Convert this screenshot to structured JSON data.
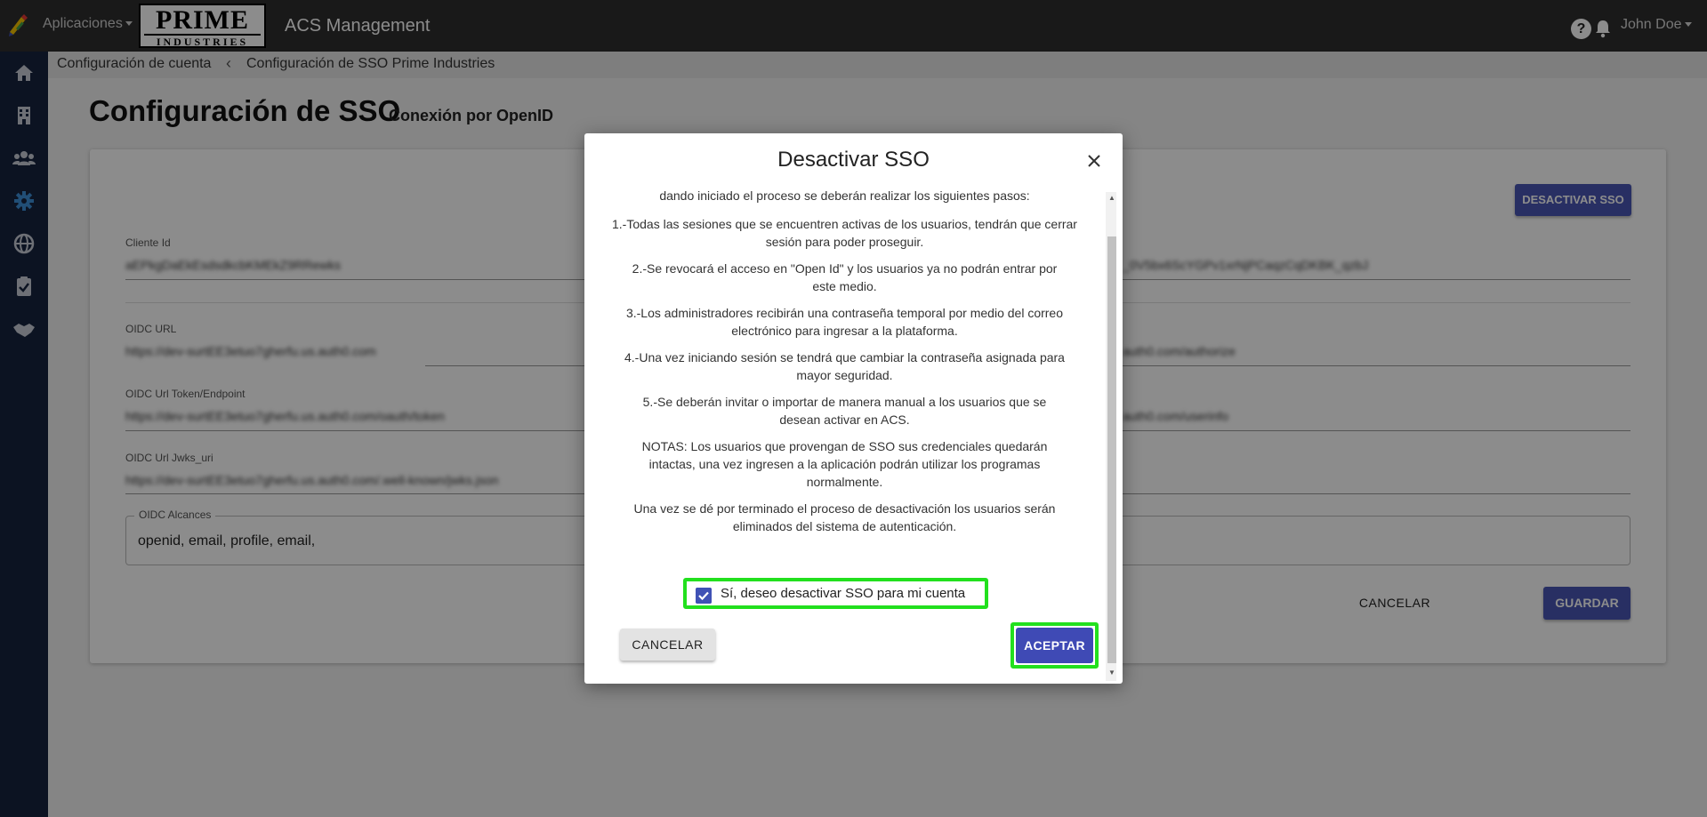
{
  "topbar": {
    "apps_label": "Aplicaciones",
    "brand_line1": "PRIME",
    "brand_line2": "INDUSTRIES",
    "app_title": "ACS Management",
    "help_glyph": "?",
    "user_name": "John Doe"
  },
  "sidebar": {
    "items": [
      "home-icon",
      "building-icon",
      "users-icon",
      "gear-icon",
      "globe-icon",
      "clipboard-check-icon",
      "handshake-icon"
    ],
    "active": "gear-icon"
  },
  "breadcrumb": {
    "items": [
      "Configuración de cuenta",
      "Configuración de SSO Prime Industries"
    ],
    "separator": "‹"
  },
  "page": {
    "title": "Configuración de SSO",
    "subtitle": "Conexión por OpenID"
  },
  "form": {
    "deactivate_label": "DESACTIVAR SSO",
    "fields": [
      {
        "label": "Cliente Id",
        "value": "aEPkgDaEkEsdsdkcbKMEkZ9RRewks",
        "value_right": "_0V5bx6ScYGPv1xrNjPCaqzCqDKBK_qzbJ"
      },
      {
        "label": "OIDC URL",
        "value": "https://dev-surtEE3etuo7gherfu.us.auth0.com",
        "value_right": "auth0.com/authorize"
      },
      {
        "label": "OIDC Url Token/Endpoint",
        "value": "https://dev-surtEE3etuo7gherfu.us.auth0.com/oauth/token",
        "value_right": "auth0.com/userinfo"
      },
      {
        "label": "OIDC Url Jwks_uri",
        "value": "https://dev-surtEE3etuo7gherfu.us.auth0.com/.well-known/jwks.json",
        "value_right": ""
      }
    ],
    "scope_label": "OIDC Alcances",
    "scope_value": "openid, email, profile, email,",
    "cancel_label": "CANCELAR",
    "save_label": "GUARDAR"
  },
  "modal": {
    "title": "Desactivar SSO",
    "paragraphs": [
      "dando iniciado el proceso se deberán realizar los siguientes pasos:",
      "1.-Todas las sesiones que se encuentren activas de los usuarios, tendrán que cerrar sesión para poder proseguir.",
      "2.-Se revocará el acceso en \"Open Id\" y los usuarios ya no podrán entrar por este medio.",
      "3.-Los administradores recibirán una contraseña temporal por medio del correo electrónico para ingresar a la plataforma.",
      "4.-Una vez iniciando sesión se tendrá que cambiar la contraseña asignada para mayor seguridad.",
      "5.-Se deberán invitar o importar de manera manual a los usuarios que se desean activar en ACS.",
      "NOTAS: Los usuarios que provengan de SSO sus credenciales quedarán intactas, una vez ingresen a la aplicación podrán utilizar los programas normalmente.",
      "Una vez se dé por terminado el proceso de desactivación los usuarios serán eliminados del sistema de autenticación."
    ],
    "checkbox_label": "Sí, deseo desactivar SSO para mi cuenta",
    "checkbox_checked": true,
    "cancel_label": "CANCELAR",
    "accept_label": "ACEPTAR",
    "highlight_color": "#22e01e",
    "accent_color": "#3f51b5"
  }
}
